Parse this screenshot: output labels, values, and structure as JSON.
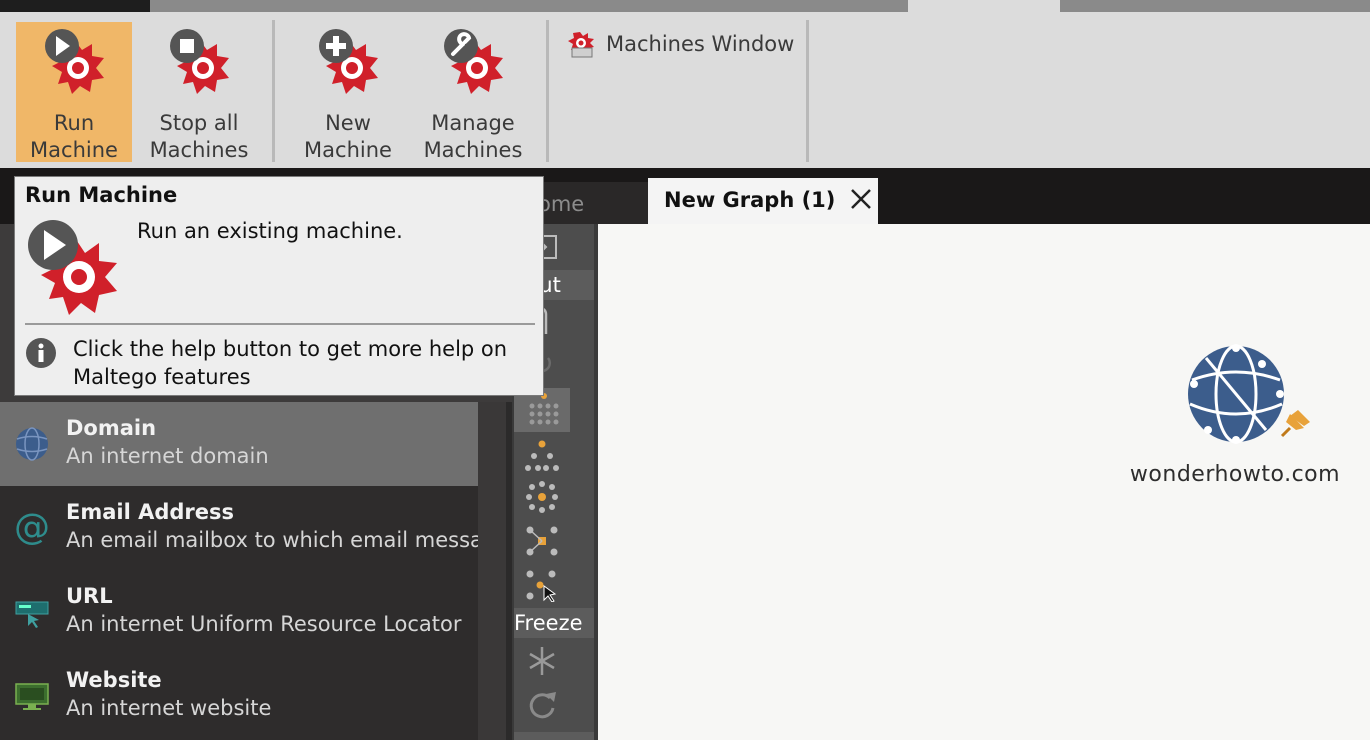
{
  "ribbon": {
    "run_machine": "Run\nMachine",
    "stop_all": "Stop all\nMachines",
    "new_machine": "New\nMachine",
    "manage_machines": "Manage\nMachines",
    "machines_window": "Machines Window"
  },
  "tabs": {
    "home": "ome",
    "new_graph": "New Graph (1)"
  },
  "toolbar": {
    "layout_label": "yout",
    "freeze_label": "Freeze"
  },
  "tooltip": {
    "title": "Run Machine",
    "description": "Run an existing machine.",
    "help_text": "Click the help button to get more help on Maltego features"
  },
  "palette": {
    "items": [
      {
        "name": "Domain",
        "description": "An internet domain",
        "icon": "globe-icon"
      },
      {
        "name": "Email Address",
        "description": "An email mailbox to which email messa",
        "icon": "at-icon"
      },
      {
        "name": "URL",
        "description": "An internet Uniform Resource Locator",
        "icon": "url-icon"
      },
      {
        "name": "Website",
        "description": "An internet website",
        "icon": "website-icon"
      }
    ]
  },
  "graph": {
    "entity_label": "wonderhowto.com",
    "entity_icon": "globe-icon"
  },
  "colors": {
    "accent": "#f0b768",
    "machine_red": "#d0202a",
    "globe_blue": "#3c5d8c",
    "pin_orange": "#e8a23a"
  }
}
